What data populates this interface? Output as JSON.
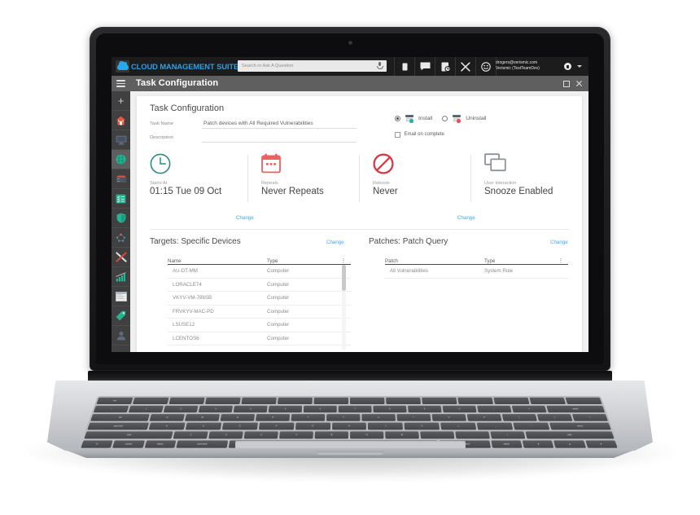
{
  "app": {
    "brand": "CLOUD MANAGEMENT SUITE",
    "page_title": "Task Configuration",
    "search": {
      "placeholder": "Search or Ask A Question"
    },
    "user": {
      "email": "drogers@verismic.com",
      "org": "Verismic (TestTeamDev)"
    },
    "window_controls": {
      "expand": "expand-icon",
      "close": "close-icon"
    },
    "accent_blue": "#42a5f5",
    "brand_blue": "#2e9fe0"
  },
  "header_icons": [
    {
      "name": "device-icon",
      "glyph": "device"
    },
    {
      "name": "chat-icon",
      "glyph": "chat"
    },
    {
      "name": "history-icon",
      "glyph": "history"
    },
    {
      "name": "tools-icon",
      "glyph": "tools"
    },
    {
      "name": "smiley-icon",
      "glyph": "smiley"
    }
  ],
  "sidebar": {
    "items": [
      {
        "name": "add-button",
        "icon": "plus-icon",
        "active": false
      },
      {
        "name": "sidebar-item-home",
        "icon": "home-icon",
        "active": false
      },
      {
        "name": "sidebar-item-devices",
        "icon": "monitor-icon",
        "active": false
      },
      {
        "name": "sidebar-item-patch",
        "icon": "globe-icon",
        "active": true
      },
      {
        "name": "sidebar-item-deploy",
        "icon": "server-icon",
        "active": false
      },
      {
        "name": "sidebar-item-tasks",
        "icon": "checklist-icon",
        "active": false
      },
      {
        "name": "sidebar-item-security",
        "icon": "shield-icon",
        "active": false
      },
      {
        "name": "sidebar-item-network",
        "icon": "network-icon",
        "active": false
      },
      {
        "name": "sidebar-item-tools",
        "icon": "tools-icon",
        "active": false
      },
      {
        "name": "sidebar-item-reports",
        "icon": "bar-chart-icon",
        "active": false
      },
      {
        "name": "sidebar-item-console",
        "icon": "window-icon",
        "active": false
      },
      {
        "name": "sidebar-item-licenses",
        "icon": "tag-icon",
        "active": false
      },
      {
        "name": "sidebar-item-users",
        "icon": "user-icon",
        "active": false
      }
    ]
  },
  "main": {
    "card_title": "Task Configuration",
    "fields": {
      "task_name_label": "Task Name",
      "task_name_value": "Patch devices with All Required Vulnerabilities",
      "description_label": "Description",
      "description_value": ""
    },
    "action": {
      "install_label": "Install",
      "uninstall_label": "Uninstall",
      "selected": "Install",
      "email_label": "Email on complete",
      "email_checked": false
    },
    "tiles": [
      {
        "name": "starts-at-tile",
        "icon": "clock-icon",
        "label": "Starts At",
        "value": "01:15 Tue 09 Oct"
      },
      {
        "name": "repeats-tile",
        "icon": "calendar-icon",
        "label": "Repeats",
        "value": "Never Repeats"
      },
      {
        "name": "reboots-tile",
        "icon": "prohibited-icon",
        "label": "Reboots",
        "value": "Never"
      },
      {
        "name": "user-interaction-tile",
        "icon": "windows-icon",
        "label": "User Interaction",
        "value": "Snooze Enabled"
      }
    ],
    "change_label": "Change",
    "targets": {
      "title": "Targets: Specific Devices",
      "change_label": "Change",
      "columns": [
        "Name",
        "Type"
      ],
      "rows": [
        {
          "name": "AU-DT-MM",
          "type": "Computer"
        },
        {
          "name": "LORACLE74",
          "type": "Computer"
        },
        {
          "name": "VKYV-VM-786SB",
          "type": "Computer"
        },
        {
          "name": "FRVKYV-MAC-PD",
          "type": "Computer"
        },
        {
          "name": "LSUSE12",
          "type": "Computer"
        },
        {
          "name": "LCENTOS6",
          "type": "Computer"
        }
      ]
    },
    "patches": {
      "title": "Patches: Patch Query",
      "change_label": "Change",
      "columns": [
        "Patch",
        "Type"
      ],
      "rows": [
        {
          "name": "All Vulnerabilities",
          "type": "System Rule"
        }
      ]
    }
  }
}
